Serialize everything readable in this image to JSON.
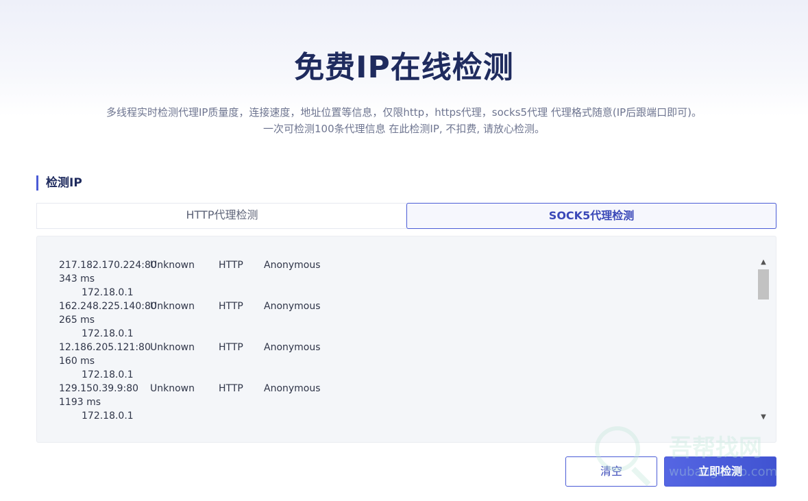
{
  "header": {
    "title": "免费IP在线检测",
    "desc_line1": "多线程实时检测代理IP质量度，连接速度，地址位置等信息，仅限http，https代理，socks5代理 代理格式随意(IP后跟端口即可)。",
    "desc_line2": "一次可检测100条代理信息 在此检测IP, 不扣费, 请放心检测。"
  },
  "section": {
    "title": "检测IP"
  },
  "tabs": [
    {
      "label": "HTTP代理检测",
      "active": false
    },
    {
      "label": "SOCK5代理检测",
      "active": true
    }
  ],
  "results": [
    {
      "ip": "217.182.170.224:80",
      "location": "Unknown",
      "protocol": "HTTP",
      "anonymity": "Anonymous",
      "speed": "343 ms",
      "origin": "172.18.0.1"
    },
    {
      "ip": "162.248.225.140:80",
      "location": "Unknown",
      "protocol": "HTTP",
      "anonymity": "Anonymous",
      "speed": "265 ms",
      "origin": "172.18.0.1"
    },
    {
      "ip": "12.186.205.121:80",
      "location": "Unknown",
      "protocol": "HTTP",
      "anonymity": "Anonymous",
      "speed": "160 ms",
      "origin": "172.18.0.1"
    },
    {
      "ip": "129.150.39.9:80",
      "location": "Unknown",
      "protocol": "HTTP",
      "anonymity": "Anonymous",
      "speed": "1193 ms",
      "origin": "172.18.0.1"
    }
  ],
  "buttons": {
    "clear": "清空",
    "check": "立即检测"
  },
  "watermark": {
    "text": "吾帮找网",
    "sub": "wubangzhao.com"
  },
  "colors": {
    "accent": "#4a5bd6",
    "title": "#1f2b5e"
  }
}
